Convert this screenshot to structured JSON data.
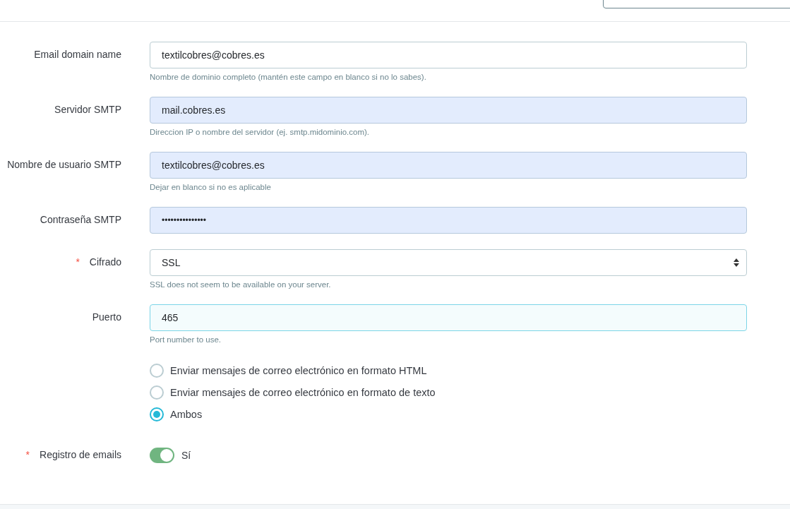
{
  "fields": [
    {
      "label": "Email domain name",
      "kind": "text",
      "value": "textilcobres@cobres.es",
      "autofilled": false,
      "focused": false,
      "help": "Nombre de dominio completo (mantén este campo en blanco si no lo sabes)."
    },
    {
      "label": "Servidor SMTP",
      "kind": "text",
      "value": "mail.cobres.es",
      "autofilled": true,
      "focused": false,
      "help": "Direccion IP o nombre del servidor (ej. smtp.midominio.com)."
    },
    {
      "label": "Nombre de usuario SMTP",
      "kind": "text",
      "value": "textilcobres@cobres.es",
      "autofilled": true,
      "focused": false,
      "help": "Dejar en blanco si no es aplicable"
    },
    {
      "label": "Contraseña SMTP",
      "kind": "password",
      "value": "•••••••••••••••",
      "autofilled": true,
      "focused": false
    },
    {
      "label": "Cifrado",
      "required_mark": "*",
      "kind": "select",
      "value": "SSL",
      "autofilled": false,
      "focused": false,
      "help": "SSL does not seem to be available on your server."
    },
    {
      "label": "Puerto",
      "kind": "text",
      "value": "465",
      "autofilled": false,
      "focused": true,
      "help": "Port number to use."
    }
  ],
  "format_options": [
    {
      "label": "Enviar mensajes de correo electrónico en formato HTML",
      "selected": false
    },
    {
      "label": "Enviar mensajes de correo electrónico en formato de texto",
      "selected": false
    },
    {
      "label": "Ambos",
      "selected": true
    }
  ],
  "email_log": {
    "label": "Registro de emails",
    "required_mark": "*",
    "on": true,
    "value_label": "Sí"
  }
}
